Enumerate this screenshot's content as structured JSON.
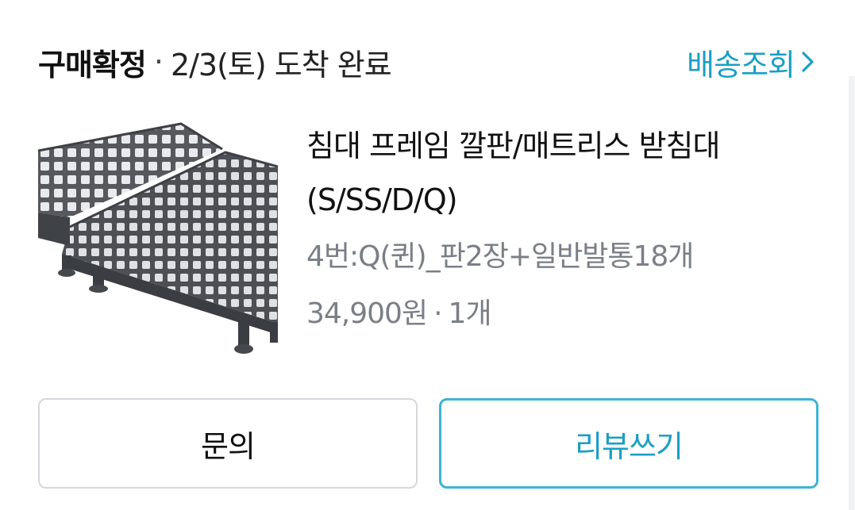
{
  "order": {
    "status_label": "구매확정",
    "separator": "·",
    "delivery_text": "2/3(토) 도착 완료",
    "track_link_label": "배송조회",
    "colors": {
      "accent": "#1a9fc4",
      "button_review_border": "#3eb3d5",
      "muted_text": "#7a7f87"
    }
  },
  "product": {
    "image_icon": "bed-frame-platform-image",
    "title_line1": "침대 프레임 깔판/매트리스 받침대",
    "title_line2": "(S/SS/D/Q)",
    "option": "4번:Q(퀸)_판2장+일반발통18개",
    "price": "34,900원",
    "separator": "·",
    "quantity": "1개"
  },
  "actions": {
    "inquiry_label": "문의",
    "review_label": "리뷰쓰기"
  }
}
